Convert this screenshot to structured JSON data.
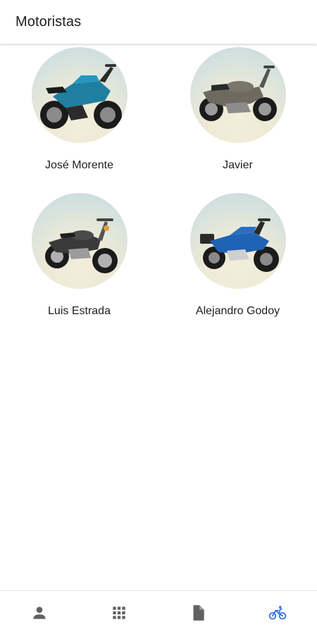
{
  "app_bar": {
    "title": "Motoristas"
  },
  "drivers": [
    {
      "name": "José Morente",
      "bike_color": "#1e7fa0"
    },
    {
      "name": "Javier",
      "bike_color": "#6e6a60"
    },
    {
      "name": "Luis Estrada",
      "bike_color": "#3a3a3a"
    },
    {
      "name": "Alejandro Godoy",
      "bike_color": "#1f63b5"
    }
  ],
  "bottom_nav": {
    "items": [
      {
        "icon": "person-icon",
        "active": false
      },
      {
        "icon": "apps-grid-icon",
        "active": false
      },
      {
        "icon": "document-icon",
        "active": false
      },
      {
        "icon": "bicycle-icon",
        "active": true
      }
    ],
    "active_color": "#2f6fe0",
    "inactive_color": "#616161"
  }
}
